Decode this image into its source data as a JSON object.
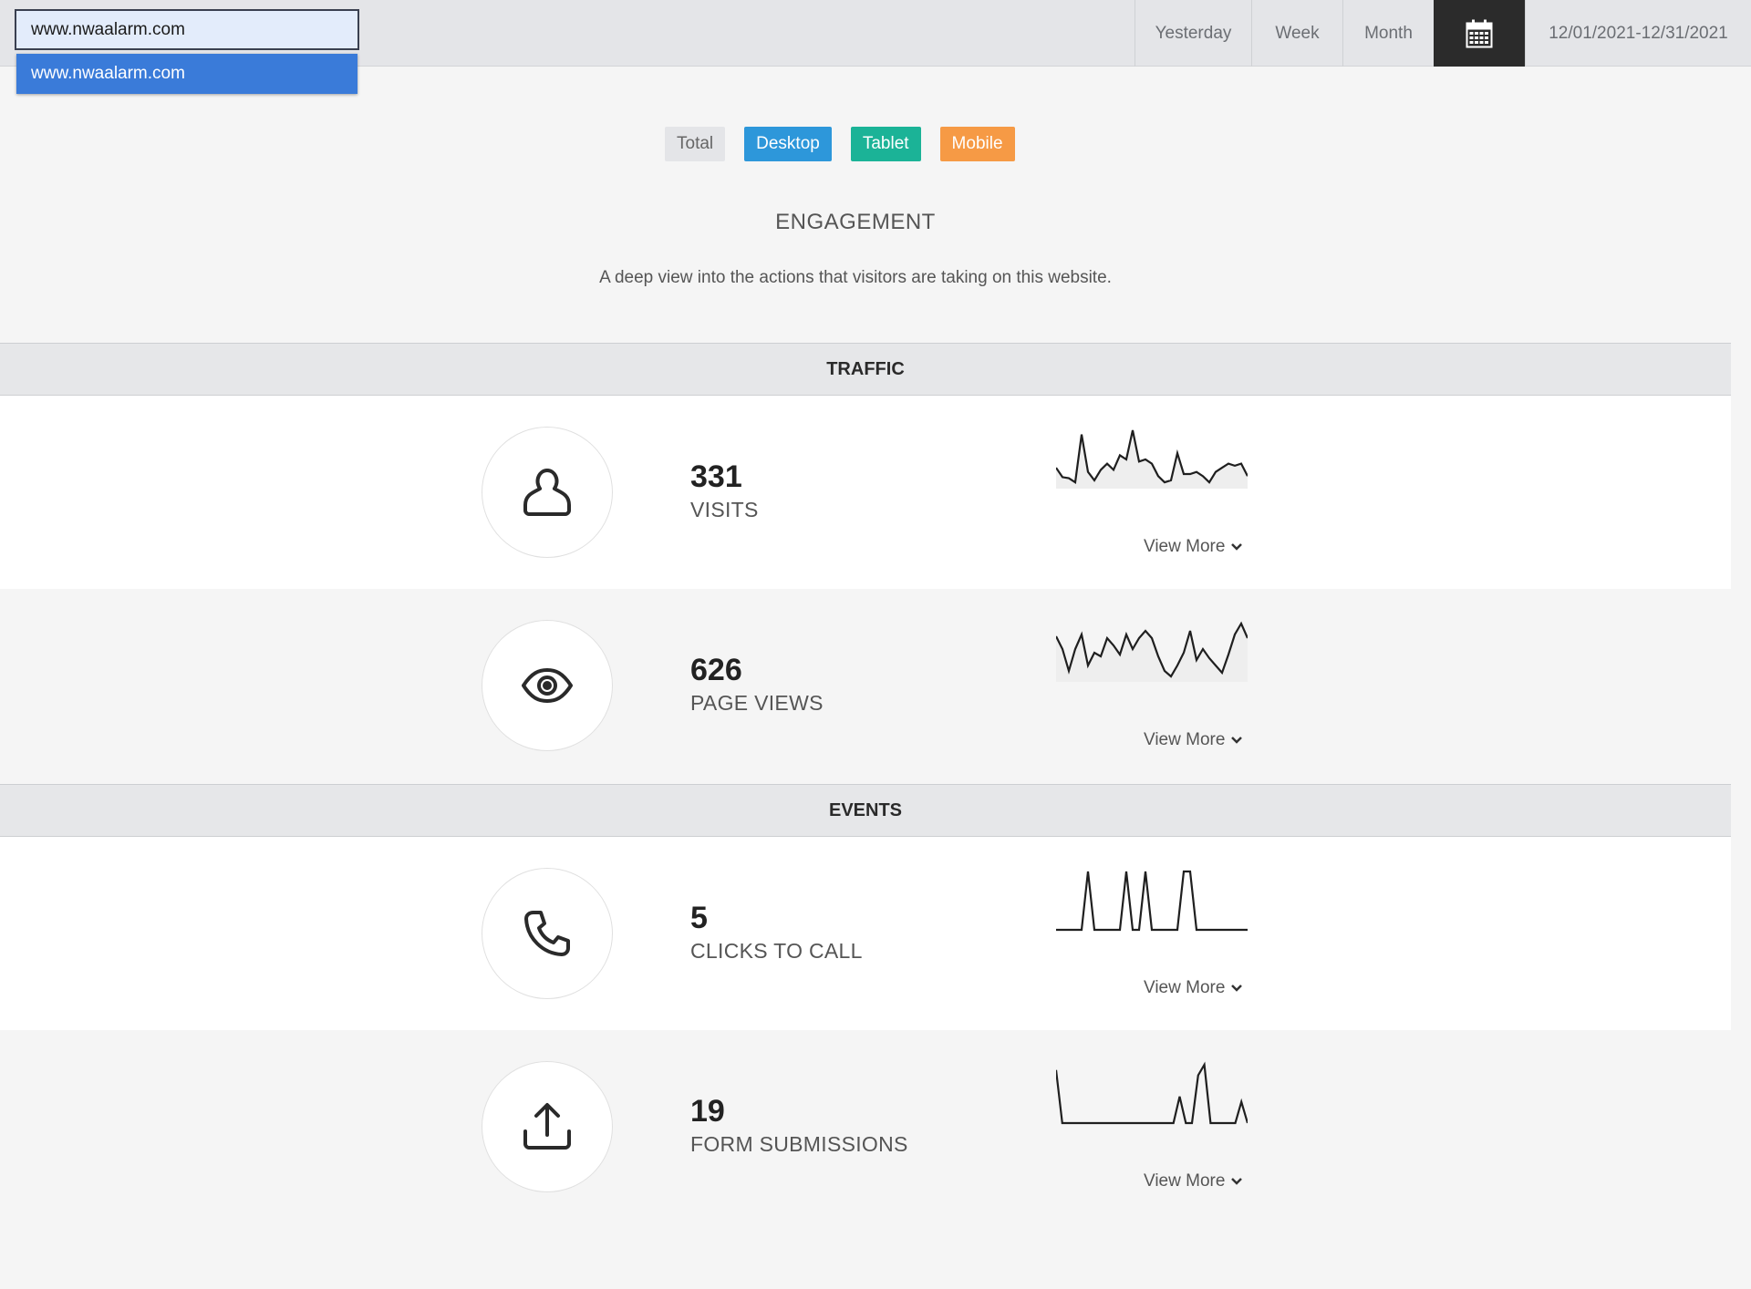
{
  "topbar": {
    "site_value": "www.nwaalarm.com",
    "dropdown_option": "www.nwaalarm.com",
    "range": {
      "yesterday": "Yesterday",
      "week": "Week",
      "month": "Month",
      "calendar_icon": "calendar-icon",
      "date_range": "12/01/2021-12/31/2021"
    }
  },
  "devices": {
    "total": "Total",
    "desktop": "Desktop",
    "tablet": "Tablet",
    "mobile": "Mobile",
    "colors": {
      "total": "#e4e5e8",
      "desktop": "#2d97da",
      "tablet": "#1bb397",
      "mobile": "#f69a45"
    }
  },
  "engagement": {
    "title": "ENGAGEMENT",
    "subtitle": "A deep view into the actions that visitors are taking on this website."
  },
  "sections": {
    "traffic": "TRAFFIC",
    "events": "EVENTS"
  },
  "metrics": [
    {
      "value": "331",
      "label": "VISITS",
      "icon": "user-icon",
      "view_more": "View More",
      "spark": [
        1,
        0.55,
        0.5,
        0.3,
        2.6,
        0.8,
        0.4,
        0.9,
        1.2,
        0.9,
        1.6,
        1.4,
        2.8,
        1.3,
        1.4,
        1.2,
        0.6,
        0.3,
        0.4,
        1.7,
        0.7,
        0.7,
        0.8,
        0.6,
        0.3,
        0.8,
        1.0,
        1.2,
        1.1,
        1.2,
        0.6
      ]
    },
    {
      "value": "626",
      "label": "PAGE VIEWS",
      "icon": "eye-icon",
      "view_more": "View More",
      "spark": [
        2.5,
        1.8,
        0.6,
        1.8,
        2.6,
        0.9,
        1.6,
        1.4,
        2.4,
        2.0,
        1.5,
        2.6,
        1.8,
        2.4,
        2.8,
        2.4,
        1.4,
        0.6,
        0.3,
        0.9,
        1.6,
        2.8,
        1.2,
        1.8,
        1.3,
        0.9,
        0.5,
        1.5,
        2.6,
        3.2,
        2.4
      ]
    },
    {
      "value": "5",
      "label": "CLICKS TO CALL",
      "icon": "phone-icon",
      "view_more": "View More",
      "spark": [
        0,
        0,
        0,
        0,
        0,
        1,
        0,
        0,
        0,
        0,
        0,
        1,
        0,
        0,
        1,
        0,
        0,
        0,
        0,
        0,
        1,
        1,
        0,
        0,
        0,
        0,
        0,
        0,
        0,
        0,
        0
      ]
    },
    {
      "value": "19",
      "label": "FORM SUBMISSIONS",
      "icon": "upload-icon",
      "view_more": "View More",
      "spark": [
        2,
        0,
        0,
        0,
        0,
        0,
        0,
        0,
        0,
        0,
        0,
        0,
        0,
        0,
        0,
        0,
        0,
        0,
        0,
        0,
        1,
        0,
        0,
        1.8,
        2.2,
        0,
        0,
        0,
        0,
        0,
        0.8,
        0
      ]
    }
  ]
}
